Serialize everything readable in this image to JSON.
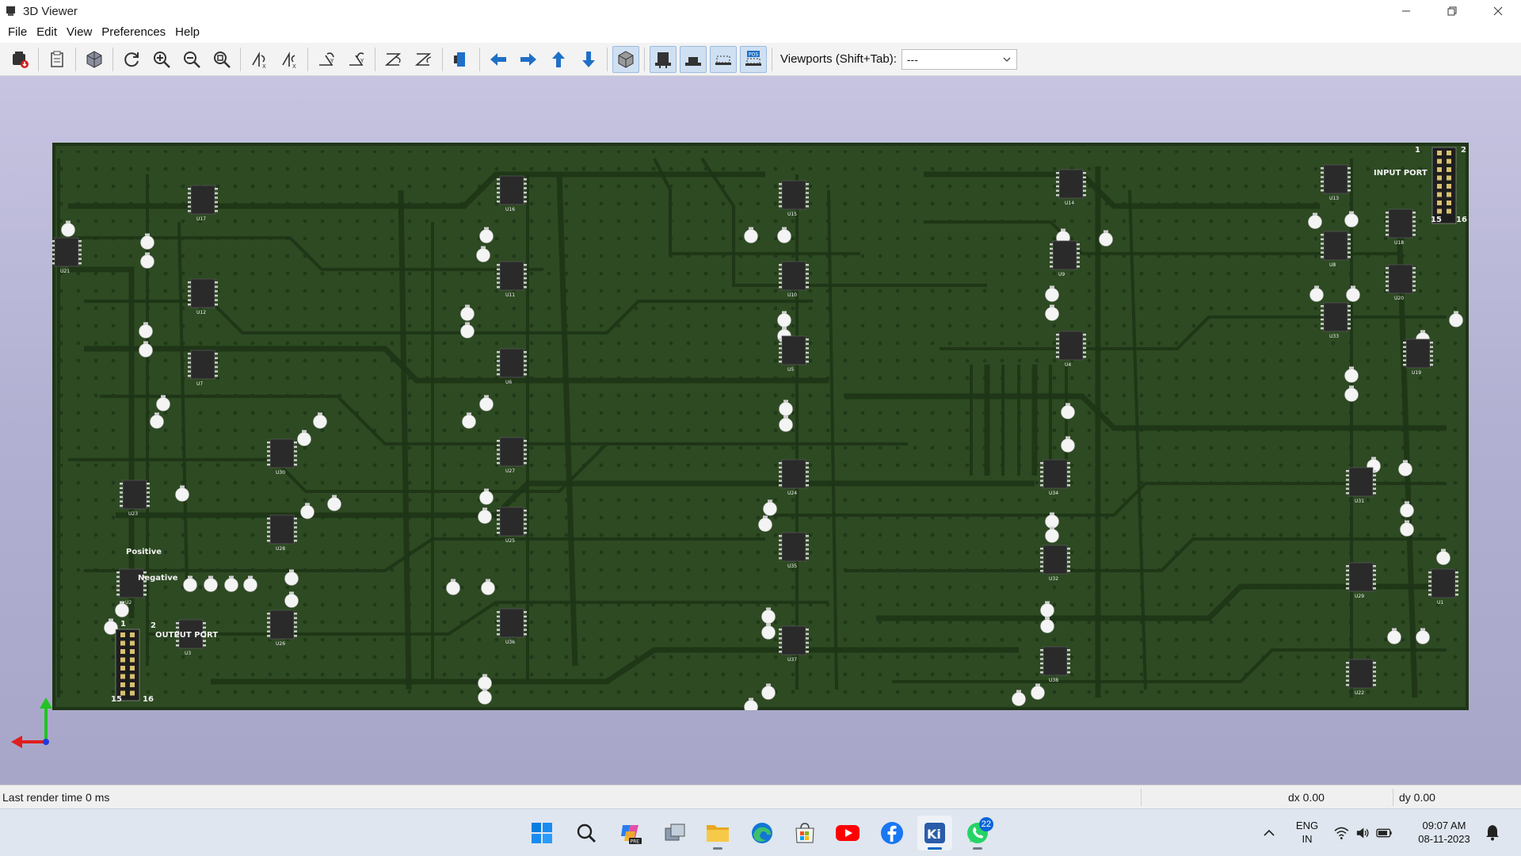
{
  "window": {
    "title": "3D Viewer",
    "controls": [
      "minimize",
      "maximize",
      "close"
    ]
  },
  "menu": [
    "File",
    "Edit",
    "View",
    "Preferences",
    "Help"
  ],
  "toolbar": {
    "buttons": [
      {
        "name": "export-image",
        "icon": "export-image-icon"
      },
      {
        "name": "copy-clipboard",
        "icon": "clipboard-icon"
      },
      {
        "name": "render-options",
        "icon": "cube-render-icon"
      },
      {
        "name": "reload-board",
        "icon": "refresh-icon"
      },
      {
        "name": "zoom-in",
        "icon": "zoom-in-icon"
      },
      {
        "name": "zoom-out",
        "icon": "zoom-out-icon"
      },
      {
        "name": "zoom-fit",
        "icon": "zoom-fit-icon"
      },
      {
        "name": "rotate-x-cw",
        "icon": "rotate-x-cw-icon"
      },
      {
        "name": "rotate-x-ccw",
        "icon": "rotate-x-ccw-icon"
      },
      {
        "name": "rotate-y-cw",
        "icon": "rotate-y-cw-icon"
      },
      {
        "name": "rotate-y-ccw",
        "icon": "rotate-y-ccw-icon"
      },
      {
        "name": "rotate-z-cw",
        "icon": "rotate-z-cw-icon"
      },
      {
        "name": "rotate-z-ccw",
        "icon": "rotate-z-ccw-icon"
      },
      {
        "name": "flip-board",
        "icon": "flip-board-icon"
      },
      {
        "name": "move-left",
        "icon": "arrow-left-icon"
      },
      {
        "name": "move-right",
        "icon": "arrow-right-icon"
      },
      {
        "name": "move-up",
        "icon": "arrow-up-icon"
      },
      {
        "name": "move-down",
        "icon": "arrow-down-icon"
      },
      {
        "name": "toggle-orthographic",
        "icon": "ortho-cube-icon"
      },
      {
        "name": "show-tht",
        "icon": "tht-footprint-icon"
      },
      {
        "name": "show-smd",
        "icon": "smd-footprint-icon"
      },
      {
        "name": "show-virtual",
        "icon": "virtual-footprint-icon"
      },
      {
        "name": "show-not-in-pos",
        "icon": "not-in-pos-icon"
      }
    ],
    "viewports_label": "Viewports (Shift+Tab):",
    "viewports_value": "---"
  },
  "pcb": {
    "silk_labels": {
      "input_port": "INPUT PORT",
      "output_port": "OUTPUT PORT",
      "positive": "Positive",
      "negative": "Negative",
      "in_pin_1": "1",
      "in_pin_2": "2",
      "in_pin_15": "15",
      "in_pin_16": "16",
      "out_pin_1": "1",
      "out_pin_2": "2",
      "out_pin_15": "15",
      "out_pin_16": "16"
    },
    "ic_refs": [
      "U17",
      "U16",
      "U15",
      "U14",
      "U13",
      "U12",
      "U11",
      "U10",
      "U9",
      "U8",
      "U7",
      "U6",
      "U5",
      "U4",
      "U33",
      "U30",
      "U27",
      "U24",
      "U34",
      "U31",
      "U28",
      "U25",
      "U35",
      "U32",
      "U29",
      "U26",
      "U36",
      "U37",
      "U38",
      "U22",
      "U23",
      "U2",
      "U3",
      "U21",
      "U18",
      "U20",
      "U19",
      "U1"
    ],
    "colors": {
      "board": "#2d4a22",
      "silkscreen": "#f2f2f2",
      "copper_trace": "#1f3517",
      "ic_body": "#2a2a2a"
    }
  },
  "status": {
    "render_time": "Last render time 0 ms",
    "dx": "dx 0.00",
    "dy": "dy 0.00"
  },
  "taskbar": {
    "apps": [
      {
        "name": "start",
        "icon": "windows-start-icon"
      },
      {
        "name": "search",
        "icon": "search-icon"
      },
      {
        "name": "copilot-pre",
        "icon": "copilot-icon"
      },
      {
        "name": "task-view",
        "icon": "task-view-icon"
      },
      {
        "name": "file-explorer",
        "icon": "folder-icon"
      },
      {
        "name": "edge",
        "icon": "edge-browser-icon"
      },
      {
        "name": "store",
        "icon": "store-icon"
      },
      {
        "name": "youtube",
        "icon": "youtube-icon"
      },
      {
        "name": "facebook",
        "icon": "facebook-icon"
      },
      {
        "name": "kicad",
        "icon": "kicad-icon"
      },
      {
        "name": "whatsapp",
        "icon": "whatsapp-icon",
        "badge": "22"
      }
    ],
    "tray": {
      "lang_1": "ENG",
      "lang_2": "IN",
      "time": "09:07 AM",
      "date": "08-11-2023"
    }
  }
}
